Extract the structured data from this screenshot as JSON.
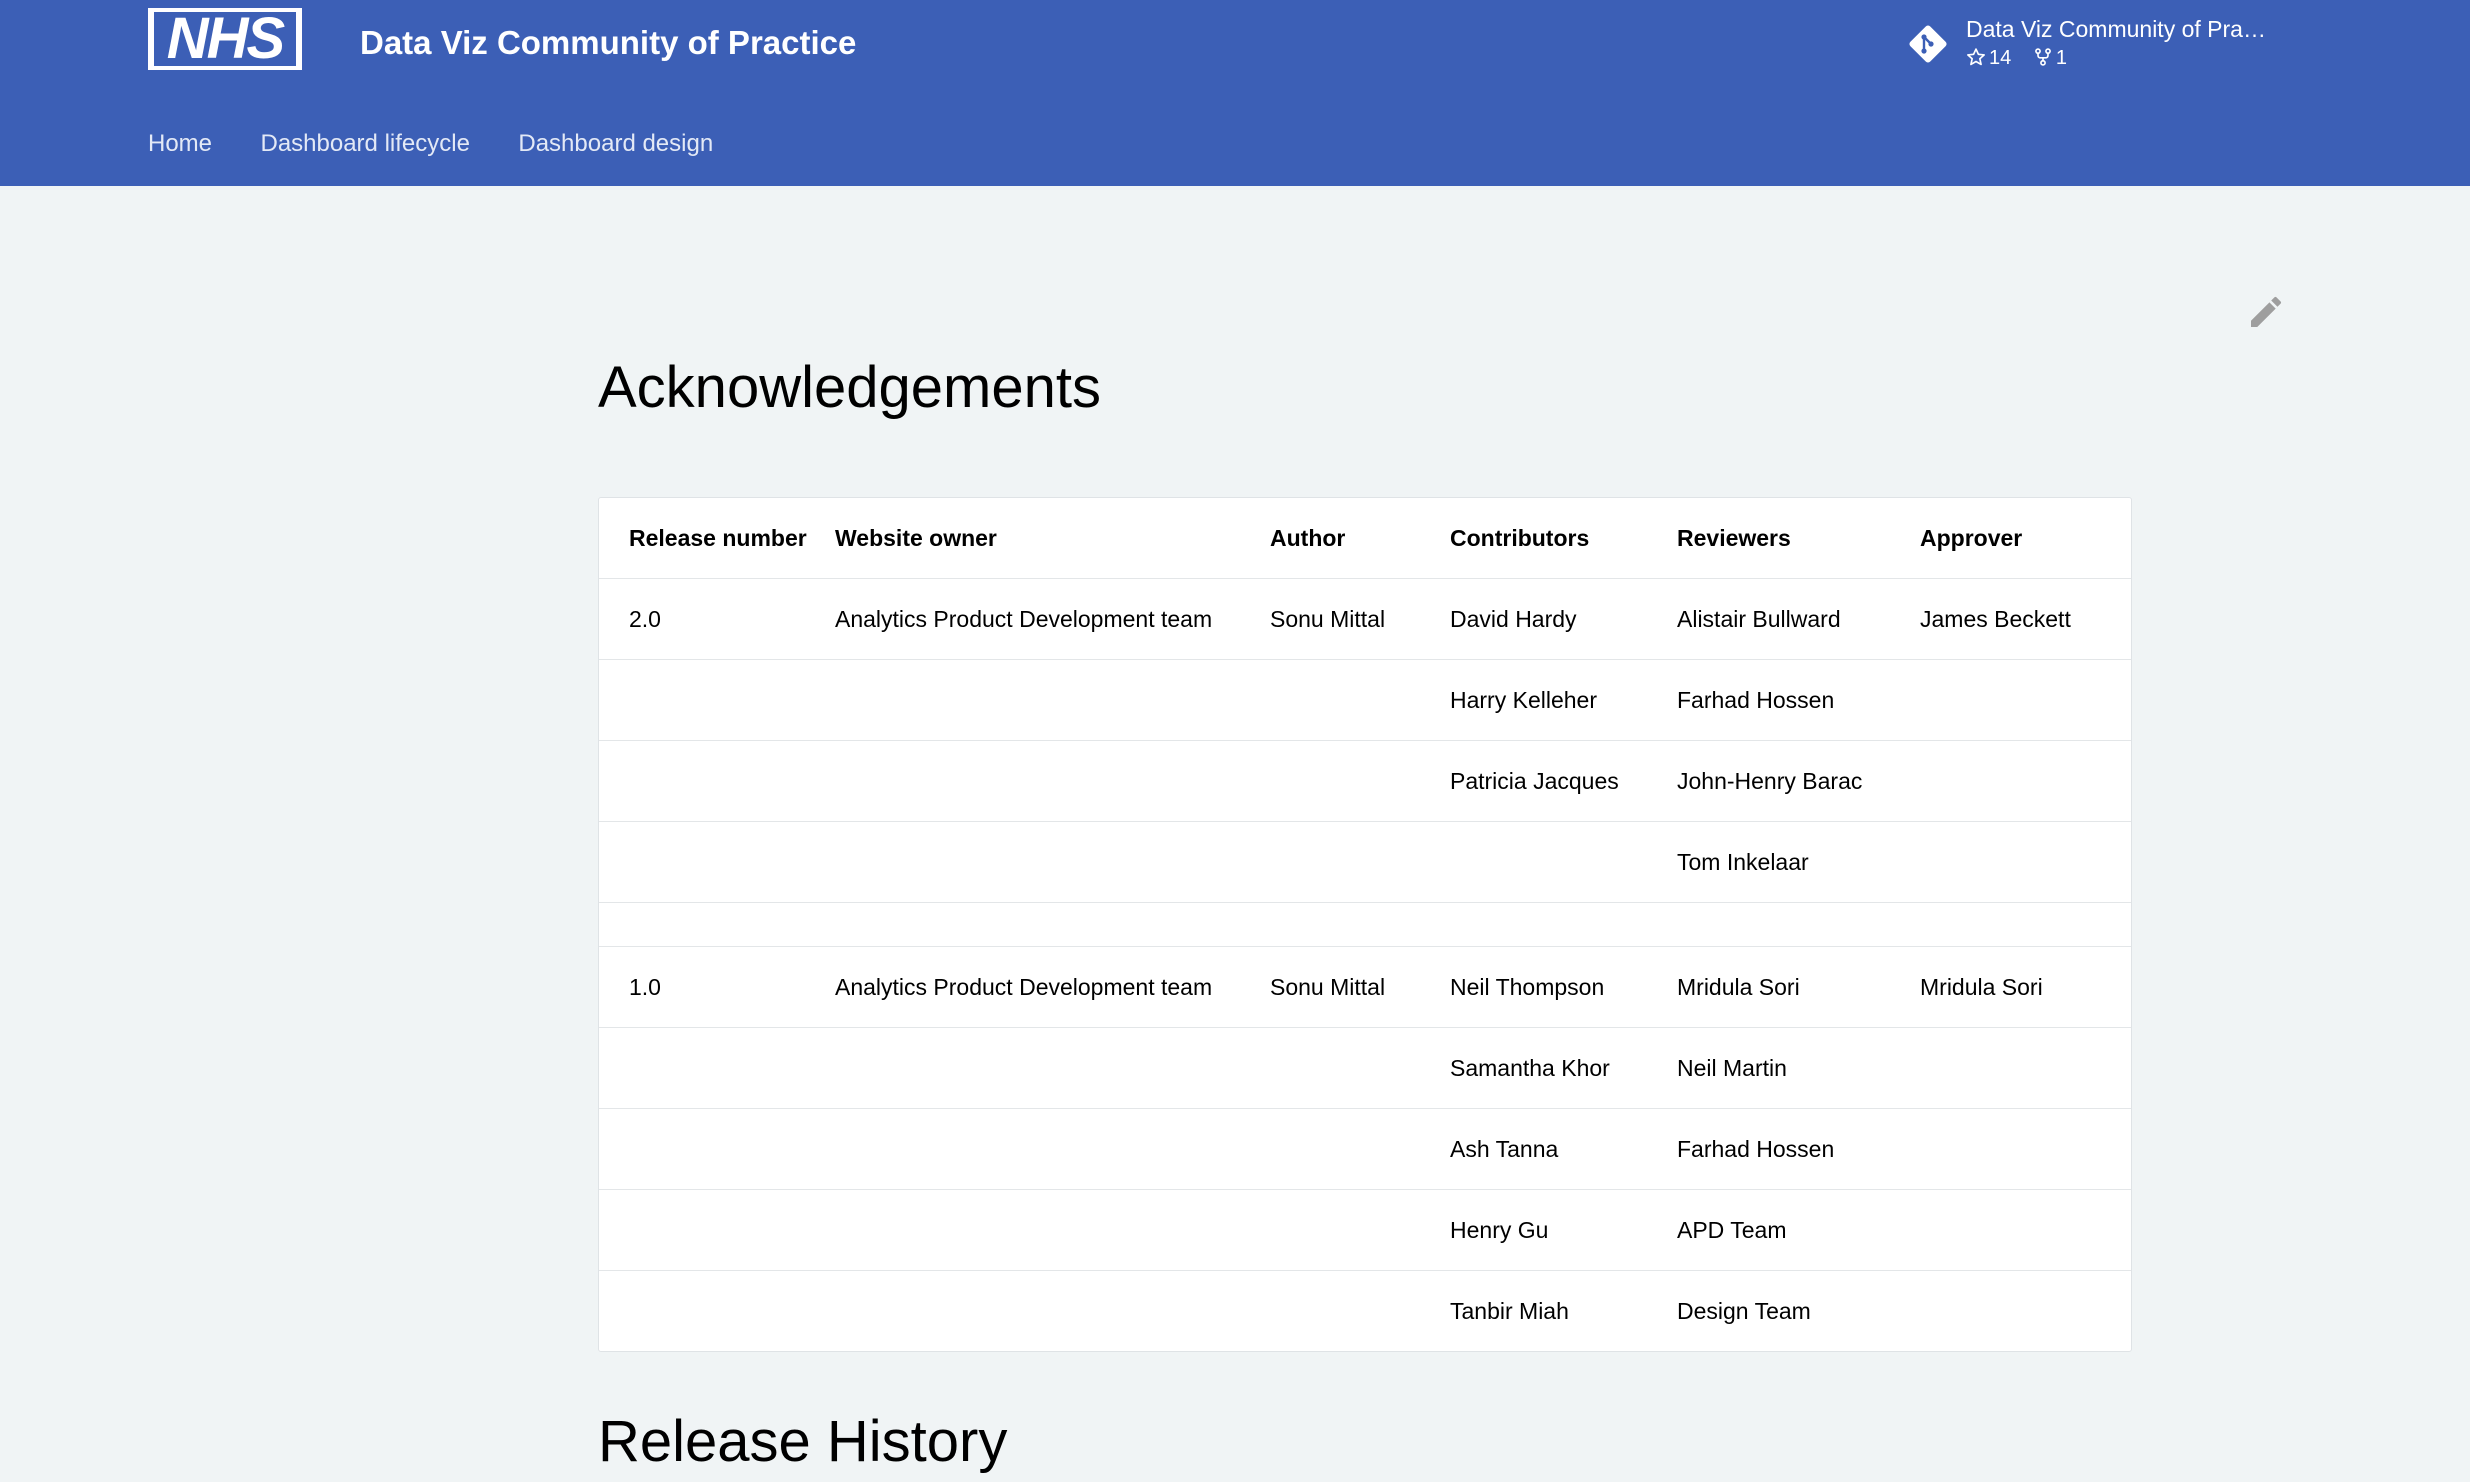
{
  "header": {
    "logo_text": "NHS",
    "site_title": "Data Viz Community of Practice",
    "repo": {
      "name": "Data Viz Community of Pra…",
      "stars": "14",
      "forks": "1"
    },
    "nav": [
      "Home",
      "Dashboard lifecycle",
      "Dashboard design"
    ]
  },
  "main": {
    "title": "Acknowledgements",
    "table": {
      "headers": [
        "Release number",
        "Website owner",
        "Author",
        "Contributors",
        "Reviewers",
        "Approver"
      ],
      "rows": [
        [
          "2.0",
          "Analytics Product Development team",
          "Sonu Mittal",
          "David Hardy",
          "Alistair Bullward",
          "James Beckett"
        ],
        [
          "",
          "",
          "",
          "Harry Kelleher",
          "Farhad Hossen",
          ""
        ],
        [
          "",
          "",
          "",
          "Patricia Jacques",
          "John-Henry Barac",
          ""
        ],
        [
          "",
          "",
          "",
          "",
          "Tom Inkelaar",
          ""
        ],
        [
          "",
          "",
          "",
          "",
          "",
          ""
        ],
        [
          "1.0",
          "Analytics Product Development team",
          "Sonu Mittal",
          "Neil Thompson",
          "Mridula Sori",
          "Mridula Sori"
        ],
        [
          "",
          "",
          "",
          "Samantha Khor",
          "Neil Martin",
          ""
        ],
        [
          "",
          "",
          "",
          "Ash Tanna",
          "Farhad Hossen",
          ""
        ],
        [
          "",
          "",
          "",
          "Henry Gu",
          "APD Team",
          ""
        ],
        [
          "",
          "",
          "",
          "Tanbir Miah",
          "Design Team",
          ""
        ]
      ]
    },
    "next_section_title": "Release History"
  },
  "colors": {
    "header_bg": "#3c5fb6",
    "page_bg": "#f0f4f5"
  },
  "icons": {
    "repo": "git-diamond-icon",
    "stars": "star-icon",
    "forks": "fork-icon",
    "edit": "pencil-icon"
  }
}
